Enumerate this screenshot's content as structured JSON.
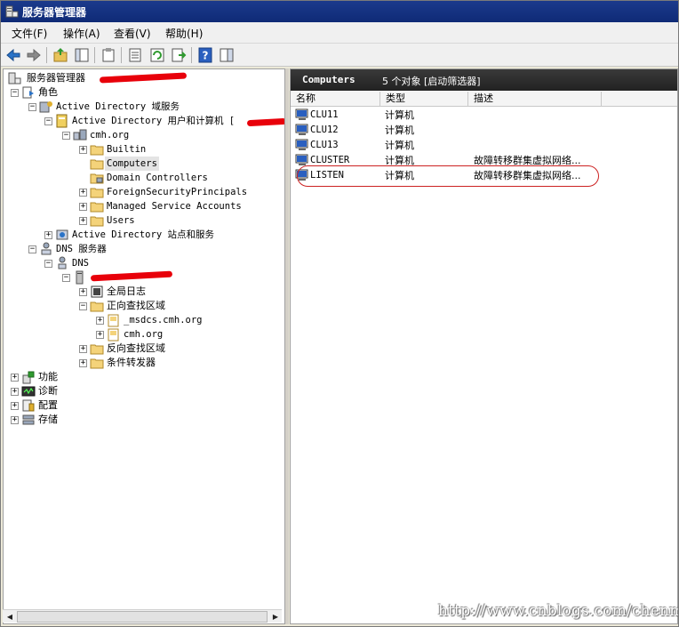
{
  "window": {
    "title": "服务器管理器"
  },
  "menu": [
    {
      "label": "文件(F)"
    },
    {
      "label": "操作(A)"
    },
    {
      "label": "查看(V)"
    },
    {
      "label": "帮助(H)"
    }
  ],
  "tree": {
    "root": "服务器管理器",
    "roles": "角色",
    "ad_ds": "Active Directory 域服务",
    "ad_users": "Active Directory 用户和计算机 [",
    "domain": "cmh.org",
    "builtin": "Builtin",
    "computers": "Computers",
    "domain_controllers": "Domain Controllers",
    "foreign": "ForeignSecurityPrincipals",
    "msa": "Managed Service Accounts",
    "users": "Users",
    "ad_sites": "Active Directory 站点和服务",
    "dns_server": "DNS 服务器",
    "dns": "DNS",
    "global_logs": "全局日志",
    "forward_zones": "正向查找区域",
    "msdcs": "_msdcs.cmh.org",
    "cmh_zone": "cmh.org",
    "reverse_zones": "反向查找区域",
    "forwarders": "条件转发器",
    "features": "功能",
    "diagnostics": "诊断",
    "configuration": "配置",
    "storage": "存储"
  },
  "panel": {
    "title": "Computers",
    "count": "5 个对象  [启动筛选器]",
    "columns": [
      "名称",
      "类型",
      "描述"
    ]
  },
  "computers": [
    {
      "name": "CLU11",
      "type": "计算机",
      "desc": ""
    },
    {
      "name": "CLU12",
      "type": "计算机",
      "desc": ""
    },
    {
      "name": "CLU13",
      "type": "计算机",
      "desc": ""
    },
    {
      "name": "CLUSTER",
      "type": "计算机",
      "desc": "故障转移群集虚拟网络..."
    },
    {
      "name": "LISTEN",
      "type": "计算机",
      "desc": "故障转移群集虚拟网络..."
    }
  ],
  "watermark": "http://www.cnblogs.com/chenmh/"
}
